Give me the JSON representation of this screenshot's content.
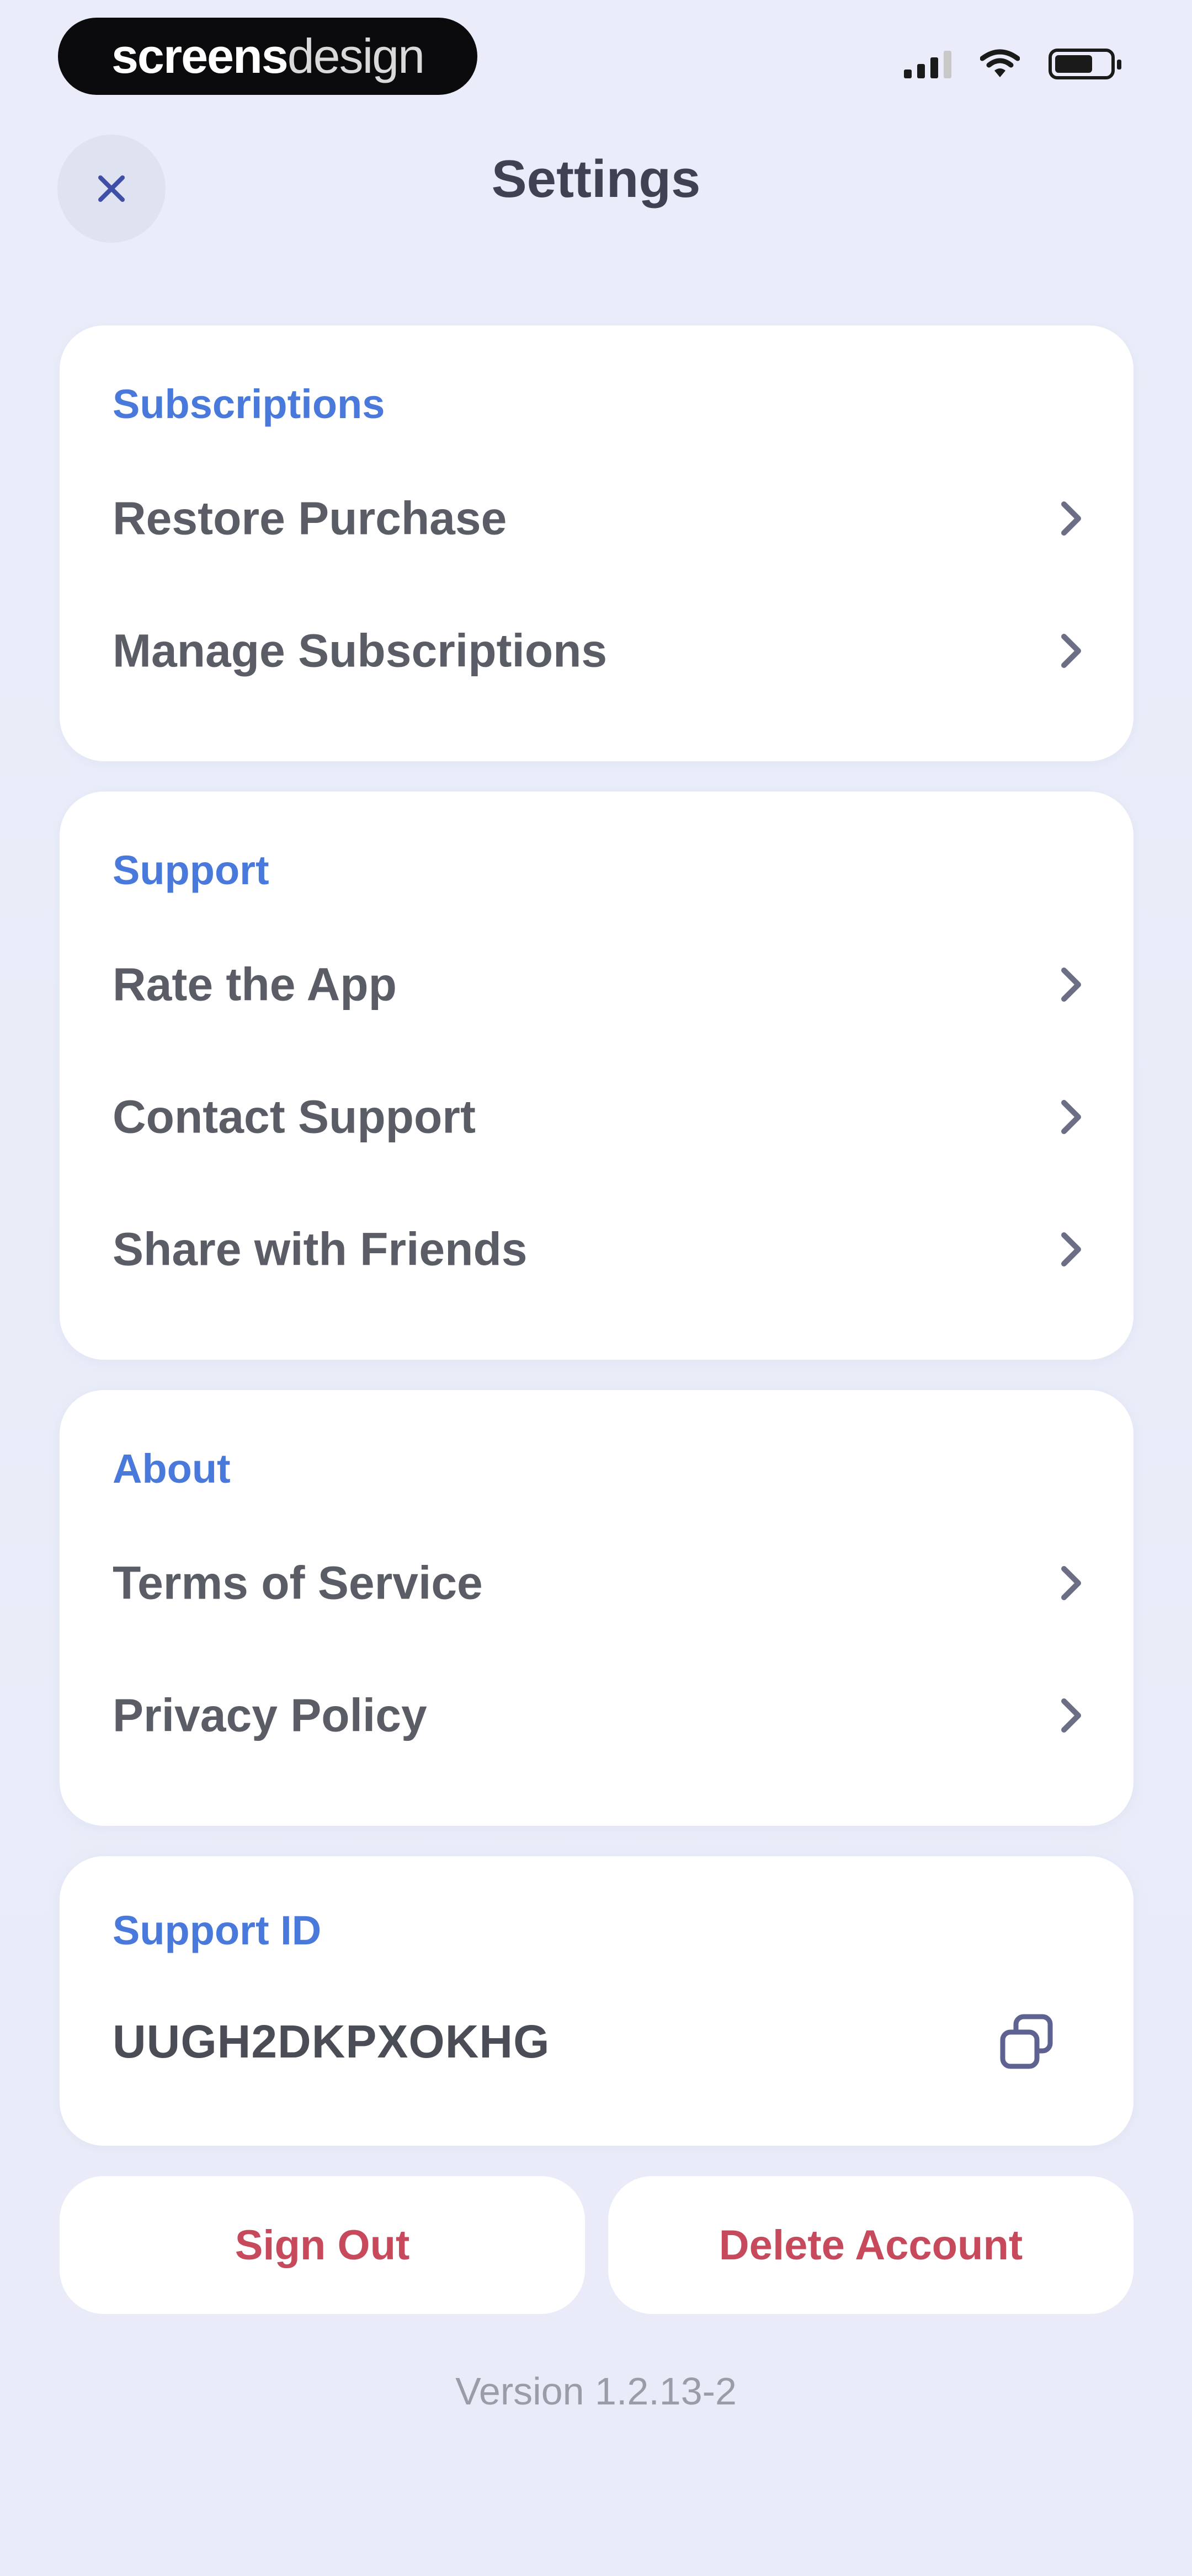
{
  "status_bar": {
    "brand_part1": "screens",
    "brand_part2": "design",
    "icons": [
      "signal-icon",
      "wifi-icon",
      "battery-icon"
    ]
  },
  "header": {
    "title": "Settings",
    "close_icon": "close-icon"
  },
  "sections": {
    "subscriptions": {
      "label": "Subscriptions",
      "items": [
        {
          "label": "Restore Purchase"
        },
        {
          "label": "Manage Subscriptions"
        }
      ]
    },
    "support": {
      "label": "Support",
      "items": [
        {
          "label": "Rate the App"
        },
        {
          "label": "Contact Support"
        },
        {
          "label": "Share with Friends"
        }
      ]
    },
    "about": {
      "label": "About",
      "items": [
        {
          "label": "Terms of Service"
        },
        {
          "label": "Privacy Policy"
        }
      ]
    },
    "support_id": {
      "label": "Support ID",
      "value": "UUGH2DKPXOKHG",
      "copy_icon": "copy-icon"
    }
  },
  "actions": {
    "sign_out": "Sign Out",
    "delete_account": "Delete Account"
  },
  "footer": {
    "version": "Version 1.2.13-2"
  },
  "colors": {
    "background": "#eaedf9",
    "card": "#ffffff",
    "section_label": "#4a79dc",
    "destructive": "#c64a5b",
    "row_text": "#5a5c66",
    "chevron": "#6b6e85"
  }
}
